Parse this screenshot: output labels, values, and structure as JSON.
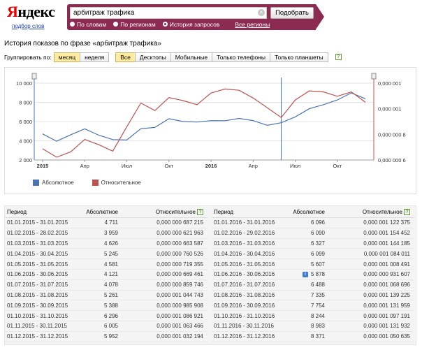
{
  "header": {
    "logo_first": "Я",
    "logo_rest": "ндекс",
    "logo_link": "подбор слов",
    "search_value": "арбитраж трафика",
    "search_button": "Подобрать",
    "radios": [
      {
        "label": "По словам",
        "checked": false
      },
      {
        "label": "По регионам",
        "checked": false
      },
      {
        "label": "История запросов",
        "checked": true
      }
    ],
    "all_regions": "Все регионы",
    "brand_color": "#8c2a52"
  },
  "page_title": "История показов по фразе «арбитраж трафика»",
  "grouping": {
    "label": "Группировать по:",
    "periods": [
      {
        "label": "месяц",
        "active": true
      },
      {
        "label": "неделя",
        "active": false
      }
    ],
    "devices": [
      {
        "label": "Все",
        "active": true
      },
      {
        "label": "Десктопы",
        "active": false
      },
      {
        "label": "Мобильные",
        "active": false
      },
      {
        "label": "Только телефоны",
        "active": false
      },
      {
        "label": "Только планшеты",
        "active": false
      }
    ],
    "help_icon": "?"
  },
  "chart_data": {
    "type": "line",
    "x": [
      "2015-01",
      "2015-02",
      "2015-03",
      "2015-04",
      "2015-05",
      "2015-06",
      "2015-07",
      "2015-08",
      "2015-09",
      "2015-10",
      "2015-11",
      "2015-12",
      "2016-01",
      "2016-02",
      "2016-03",
      "2016-04",
      "2016-05",
      "2016-06",
      "2016-07",
      "2016-08",
      "2016-09",
      "2016-10",
      "2016-11",
      "2016-12"
    ],
    "x_tick_labels": [
      {
        "x": "2015-01",
        "label": "2015",
        "bold": true
      },
      {
        "x": "2015-04",
        "label": "Апр",
        "bold": false
      },
      {
        "x": "2015-07",
        "label": "Июл",
        "bold": false
      },
      {
        "x": "2015-10",
        "label": "Окт",
        "bold": false
      },
      {
        "x": "2016-01",
        "label": "2016",
        "bold": true
      },
      {
        "x": "2016-04",
        "label": "Апр",
        "bold": false
      },
      {
        "x": "2016-07",
        "label": "Июл",
        "bold": false
      },
      {
        "x": "2016-10",
        "label": "Окт",
        "bold": false
      }
    ],
    "series": [
      {
        "name": "Абсолютное",
        "axis": "left",
        "color": "#4a74b4",
        "values": [
          4711,
          3959,
          4626,
          5245,
          4581,
          4121,
          4078,
          5261,
          5388,
          6296,
          6005,
          5952,
          6096,
          6090,
          6327,
          6099,
          5607,
          5878,
          6488,
          7335,
          7754,
          8244,
          8983,
          8371
        ]
      },
      {
        "name": "Относительное",
        "axis": "right",
        "color": "#c0504d",
        "values": [
          6.87215e-07,
          6.21963e-07,
          6.63587e-07,
          7.60526e-07,
          7.19355e-07,
          6.69461e-07,
          8.59746e-07,
          1.044743e-06,
          9.85908e-07,
          1.086921e-06,
          1.063466e-06,
          1.032194e-06,
          1.122375e-06,
          1.154452e-06,
          1.144185e-06,
          1.084011e-06,
          1.008491e-06,
          9.31607e-07,
          1.068696e-06,
          1.139225e-06,
          1.131959e-06,
          1.097191e-06,
          1.131932e-06,
          1.050635e-06
        ]
      }
    ],
    "y_left": {
      "range": [
        2000,
        10000
      ],
      "ticks": [
        2000,
        4000,
        6000,
        8000,
        10000
      ],
      "tick_labels": [
        "2 000",
        "4 000",
        "6 000",
        "8 000",
        "10 000"
      ]
    },
    "y_right": {
      "range": [
        6e-07,
        1.2e-06
      ],
      "ticks": [
        6e-07,
        8e-07,
        1e-06,
        1.2e-06
      ],
      "tick_labels": [
        "0,000 000 6",
        "0,000 000 8",
        "0,000 001",
        "0,000 001"
      ]
    },
    "cursor_x": "2016-06",
    "grid": true,
    "legend": "bottom-left"
  },
  "table_headers": {
    "period": "Период",
    "absolute": "Абсолютное",
    "relative": "Относительное"
  },
  "table_left": [
    {
      "period": "01.01.2015 - 31.01.2015",
      "abs": "4 711",
      "rel": "0,000 000 687 215"
    },
    {
      "period": "01.02.2015 - 28.02.2015",
      "abs": "3 959",
      "rel": "0,000 000 621 963"
    },
    {
      "period": "01.03.2015 - 31.03.2015",
      "abs": "4 626",
      "rel": "0,000 000 663 587"
    },
    {
      "period": "01.04.2015 - 30.04.2015",
      "abs": "5 245",
      "rel": "0,000 000 760 526"
    },
    {
      "period": "01.05.2015 - 31.05.2015",
      "abs": "4 581",
      "rel": "0,000 000 719 355"
    },
    {
      "period": "01.06.2015 - 30.06.2015",
      "abs": "4 121",
      "rel": "0,000 000 669 461"
    },
    {
      "period": "01.07.2015 - 31.07.2015",
      "abs": "4 078",
      "rel": "0,000 000 859 746"
    },
    {
      "period": "01.08.2015 - 31.08.2015",
      "abs": "5 261",
      "rel": "0,000 001 044 743"
    },
    {
      "period": "01.09.2015 - 30.09.2015",
      "abs": "5 388",
      "rel": "0,000 000 985 908"
    },
    {
      "period": "01.10.2015 - 31.10.2015",
      "abs": "6 296",
      "rel": "0,000 001 086 921"
    },
    {
      "period": "01.11.2015 - 30.11.2015",
      "abs": "6 005",
      "rel": "0,000 001 063 466"
    },
    {
      "period": "01.12.2015 - 31.12.2015",
      "abs": "5 952",
      "rel": "0,000 001 032 194"
    }
  ],
  "table_right": [
    {
      "period": "01.01.2016 - 31.01.2016",
      "abs": "6 096",
      "rel": "0,000 001 122 375"
    },
    {
      "period": "01.02.2016 - 29.02.2016",
      "abs": "6 090",
      "rel": "0,000 001 154 452"
    },
    {
      "period": "01.03.2016 - 31.03.2016",
      "abs": "6 327",
      "rel": "0,000 001 144 185"
    },
    {
      "period": "01.04.2016 - 30.04.2016",
      "abs": "6 099",
      "rel": "0,000 001 084 011"
    },
    {
      "period": "01.05.2016 - 31.05.2016",
      "abs": "5 607",
      "rel": "0,000 001 008 491"
    },
    {
      "period": "01.06.2016 - 30.06.2016",
      "abs": "5 878",
      "rel": "0,000 000 931 607"
    },
    {
      "period": "01.07.2016 - 31.07.2016",
      "abs": "6 488",
      "rel": "0,000 001 068 696"
    },
    {
      "period": "01.08.2016 - 31.08.2016",
      "abs": "7 335",
      "rel": "0,000 001 139 225"
    },
    {
      "period": "01.09.2016 - 30.09.2016",
      "abs": "7 754",
      "rel": "0,000 001 131 959"
    },
    {
      "period": "01.10.2016 - 31.10.2016",
      "abs": "8 244",
      "rel": "0,000 001 097 191"
    },
    {
      "period": "01.11.2016 - 30.11.2016",
      "abs": "8 983",
      "rel": "0,000 001 131 932"
    },
    {
      "period": "01.12.2016 - 31.12.2016",
      "abs": "8 371",
      "rel": "0,000 001 050 635"
    }
  ],
  "info_icon": {
    "label": "i",
    "row": 5
  }
}
